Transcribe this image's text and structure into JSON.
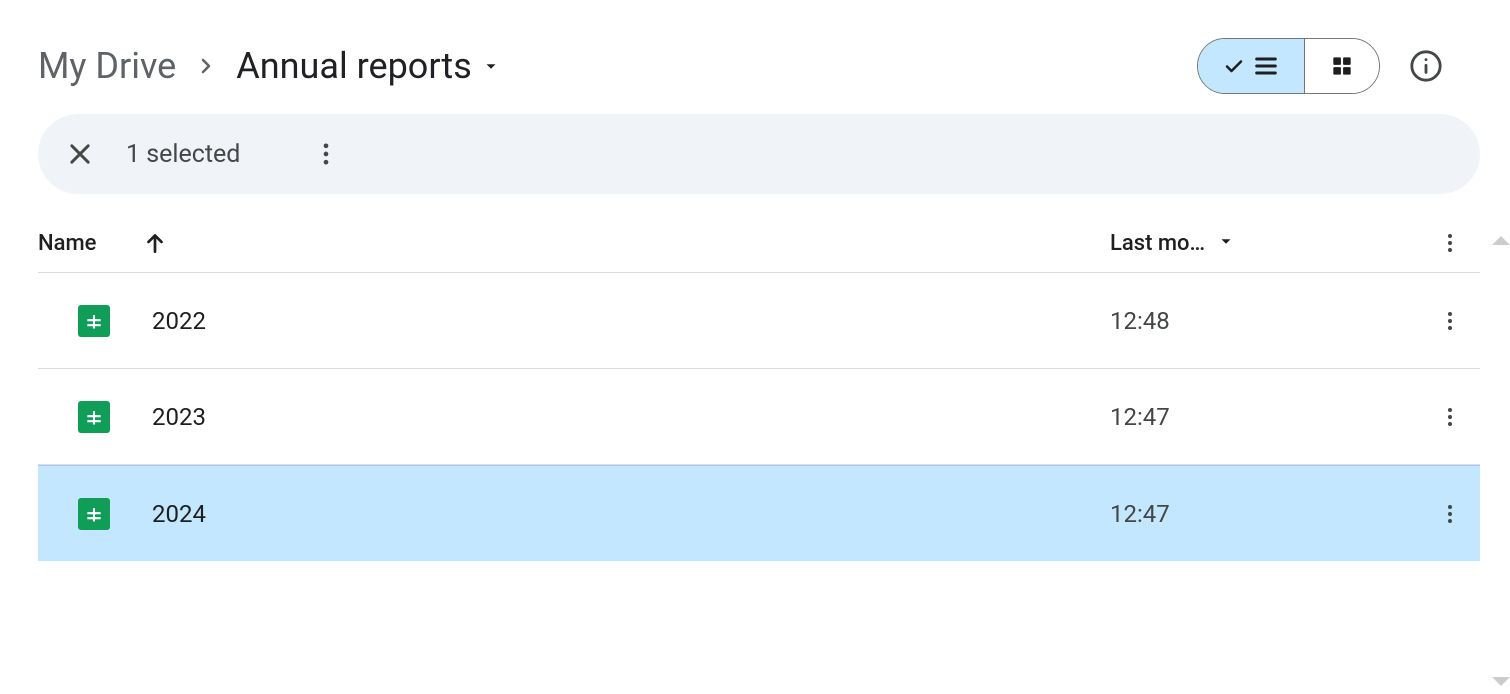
{
  "breadcrumb": {
    "root": "My Drive",
    "current": "Annual reports"
  },
  "selection_bar": {
    "label": "1 selected"
  },
  "table": {
    "columns": {
      "name": "Name",
      "modified": "Last mo…"
    }
  },
  "files": [
    {
      "name": "2022",
      "modified": "12:48",
      "selected": false
    },
    {
      "name": "2023",
      "modified": "12:47",
      "selected": false
    },
    {
      "name": "2024",
      "modified": "12:47",
      "selected": true
    }
  ]
}
